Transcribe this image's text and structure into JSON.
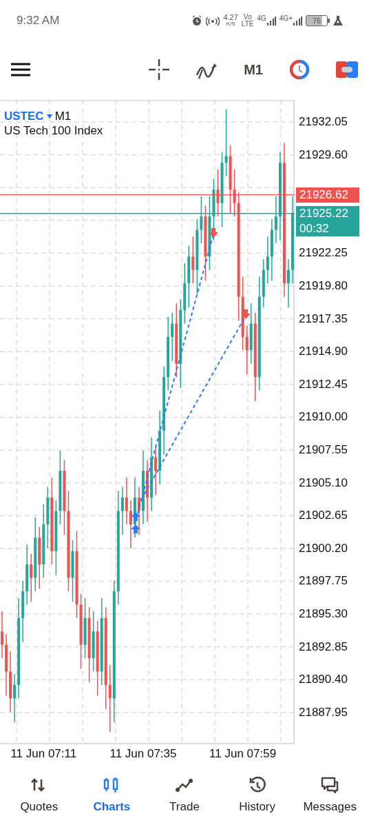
{
  "status_bar": {
    "time": "9:32 AM",
    "speed": "4.27",
    "speed_unit": "K/S",
    "volte_top": "Vo",
    "volte_bottom": "LTE",
    "network_1": "4G",
    "network_2": "4G+",
    "battery": "76"
  },
  "toolbar": {
    "timeframe": "M1"
  },
  "chart": {
    "symbol": "USTEC",
    "timeframe": "M1",
    "description": "US Tech 100 Index",
    "ask_label": "21926.62",
    "bid_label": "21925.22",
    "bar_timer": "00:32",
    "chart_data": {
      "type": "candlestick",
      "categories": [
        null,
        null,
        null,
        null,
        null,
        null,
        null,
        null,
        null,
        null,
        "11 Jun 07:11",
        null,
        null,
        null,
        null,
        null,
        null,
        null,
        null,
        null,
        null,
        null,
        null,
        null,
        null,
        null,
        null,
        null,
        null,
        null,
        null,
        null,
        null,
        null,
        "11 Jun 07:35",
        null,
        null,
        null,
        null,
        null,
        null,
        null,
        null,
        null,
        null,
        null,
        null,
        null,
        null,
        null,
        null,
        null,
        null,
        null,
        null,
        null,
        null,
        null,
        "11 Jun 07:59",
        null,
        null,
        null,
        null,
        null,
        null,
        null,
        null,
        null,
        null,
        null,
        null
      ],
      "ylim": [
        21885.57,
        21933.7
      ],
      "grid": true,
      "ohlc": [
        [
          21894,
          21895.5,
          21892,
          21893
        ],
        [
          21893,
          21893.8,
          21889.2,
          21891
        ],
        [
          21891,
          21892.5,
          21888,
          21889
        ],
        [
          21889,
          21890.8,
          21887.2,
          21890
        ],
        [
          21890,
          21896.5,
          21889,
          21895
        ],
        [
          21895,
          21897.8,
          21893.2,
          21897
        ],
        [
          21897,
          21900.5,
          21896,
          21899
        ],
        [
          21899,
          21899.8,
          21896.2,
          21898
        ],
        [
          21898,
          21902.5,
          21897,
          21901
        ],
        [
          21901,
          21901.8,
          21897.2,
          21899
        ],
        [
          21899,
          21903.5,
          21898,
          21902
        ],
        [
          21902,
          21904.8,
          21900.2,
          21904
        ],
        [
          21904,
          21905.5,
          21899,
          21900
        ],
        [
          21900,
          21903.8,
          21898.2,
          21903
        ],
        [
          21903,
          21907.5,
          21902,
          21906
        ],
        [
          21906,
          21906.8,
          21901.2,
          21903
        ],
        [
          21903,
          21904.5,
          21897,
          21898
        ],
        [
          21898,
          21900.8,
          21896.2,
          21900
        ],
        [
          21900,
          21901.5,
          21895,
          21896
        ],
        [
          21896,
          21896.8,
          21891.2,
          21893
        ],
        [
          21893,
          21896.5,
          21892,
          21895
        ],
        [
          21895,
          21895.8,
          21890.2,
          21892
        ],
        [
          21892,
          21895.5,
          21891,
          21894
        ],
        [
          21894,
          21894.8,
          21889.2,
          21891
        ],
        [
          21891,
          21896.5,
          21890,
          21895
        ],
        [
          21895,
          21895.8,
          21888.2,
          21890
        ],
        [
          21890,
          21891.5,
          21886.5,
          21889
        ],
        [
          21889,
          21897.8,
          21887.2,
          21897
        ],
        [
          21897,
          21904.5,
          21896,
          21903
        ],
        [
          21903,
          21904.8,
          21901.2,
          21904
        ],
        [
          21904,
          21905.5,
          21902,
          21903
        ],
        [
          21903,
          21903.8,
          21900.2,
          21902
        ],
        [
          21902,
          21905.5,
          21901,
          21904
        ],
        [
          21904,
          21904.8,
          21901.2,
          21903
        ],
        [
          21903,
          21907.5,
          21902,
          21906
        ],
        [
          21906,
          21906.8,
          21902.2,
          21904
        ],
        [
          21904,
          21908.5,
          21903,
          21907
        ],
        [
          21907,
          21907.8,
          21904.2,
          21906
        ],
        [
          21906,
          21910.5,
          21905,
          21909
        ],
        [
          21909,
          21913.8,
          21907.2,
          21913
        ],
        [
          21913,
          21917.5,
          21912,
          21916
        ],
        [
          21916,
          21917.8,
          21914.2,
          21917
        ],
        [
          21917,
          21918.5,
          21913,
          21914
        ],
        [
          21914,
          21918.8,
          21912.2,
          21918
        ],
        [
          21918,
          21921.5,
          21917,
          21920
        ],
        [
          21920,
          21922.8,
          21918.2,
          21922
        ],
        [
          21922,
          21923.5,
          21920,
          21921
        ],
        [
          21921,
          21924.8,
          21919.2,
          21924
        ],
        [
          21924,
          21926.5,
          21923,
          21925
        ],
        [
          21925,
          21925.8,
          21920.2,
          21922
        ],
        [
          21922,
          21926.5,
          21921,
          21925
        ],
        [
          21925,
          21927.8,
          21923.2,
          21927
        ],
        [
          21927,
          21928.5,
          21925,
          21926
        ],
        [
          21926,
          21929.8,
          21924.2,
          21929
        ],
        [
          21929,
          21933,
          21928,
          21929.5
        ],
        [
          21929.5,
          21930.3,
          21925.2,
          21927
        ],
        [
          21927,
          21928.5,
          21925,
          21926
        ],
        [
          21926,
          21926.8,
          21917.2,
          21919
        ],
        [
          21919,
          21920.5,
          21915,
          21916
        ],
        [
          21916,
          21916.8,
          21913.2,
          21915
        ],
        [
          21915,
          21918.5,
          21914,
          21917
        ],
        [
          21917,
          21917.8,
          21911.2,
          21913
        ],
        [
          21913,
          21920.5,
          21912,
          21919
        ],
        [
          21919,
          21921.8,
          21918.2,
          21921
        ],
        [
          21921,
          21923.5,
          21920,
          21922
        ],
        [
          21922,
          21924.8,
          21920.2,
          21924
        ],
        [
          21924,
          21926.5,
          21923,
          21925
        ],
        [
          21925,
          21929.8,
          21923.2,
          21929
        ],
        [
          21929,
          21930.5,
          21919,
          21920
        ],
        [
          21920,
          21921.8,
          21918.2,
          21921
        ],
        [
          21921,
          21926.5,
          21920,
          21925.2
        ]
      ],
      "yticks": [
        {
          "value": 21932.05,
          "label": "21932.05"
        },
        {
          "value": 21929.6,
          "label": "21929.60"
        },
        {
          "value": 21922.25,
          "label": "21922.25"
        },
        {
          "value": 21919.8,
          "label": "21919.80"
        },
        {
          "value": 21917.35,
          "label": "21917.35"
        },
        {
          "value": 21914.9,
          "label": "21914.90"
        },
        {
          "value": 21912.45,
          "label": "21912.45"
        },
        {
          "value": 21910,
          "label": "21910.00"
        },
        {
          "value": 21907.55,
          "label": "21907.55"
        },
        {
          "value": 21905.1,
          "label": "21905.10"
        },
        {
          "value": 21902.65,
          "label": "21902.65"
        },
        {
          "value": 21900.2,
          "label": "21900.20"
        },
        {
          "value": 21897.75,
          "label": "21897.75"
        },
        {
          "value": 21895.3,
          "label": "21895.30"
        },
        {
          "value": 21892.85,
          "label": "21892.85"
        },
        {
          "value": 21890.4,
          "label": "21890.40"
        },
        {
          "value": 21887.95,
          "label": "21887.95"
        }
      ]
    }
  },
  "nav": [
    {
      "label": "Quotes",
      "kind": "quotes",
      "selected": false
    },
    {
      "label": "Charts",
      "kind": "charts",
      "selected": true
    },
    {
      "label": "Trade",
      "kind": "trade",
      "selected": false
    },
    {
      "label": "History",
      "kind": "history",
      "selected": false
    },
    {
      "label": "Messages",
      "kind": "messages",
      "selected": false
    }
  ]
}
